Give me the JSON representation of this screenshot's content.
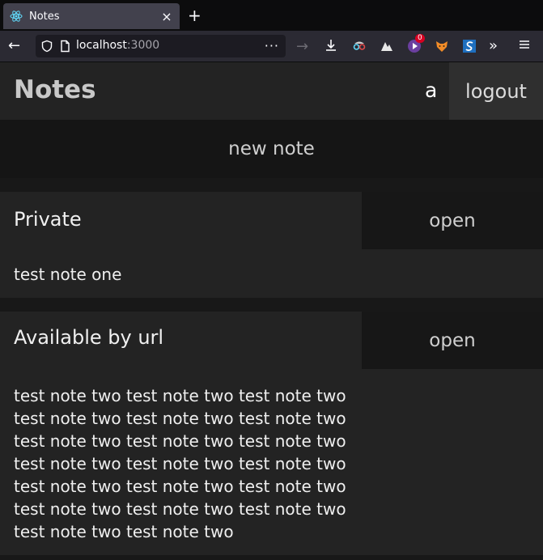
{
  "browser": {
    "tab": {
      "title": "Notes"
    },
    "new_tab": "+",
    "url": {
      "host": "localhost",
      "port": ":3000"
    },
    "extension_badge": "0"
  },
  "app": {
    "title": "Notes",
    "username": "a",
    "logout_label": "logout",
    "new_note_label": "new note",
    "notes": [
      {
        "title": "Private",
        "open_label": "open",
        "body": "test note one"
      },
      {
        "title": "Available by url",
        "open_label": "open",
        "body": "test note two test note two test note two test note two test note two test note two test note two test note two test note two test note two test note two test note two test note two test note two test note two test note two test note two test note two test note two test note two"
      }
    ]
  },
  "colors": {
    "page_bg": "#181818",
    "card_bg": "#232323",
    "button_dark": "#171717",
    "logout_bg": "#2f2f2f"
  }
}
